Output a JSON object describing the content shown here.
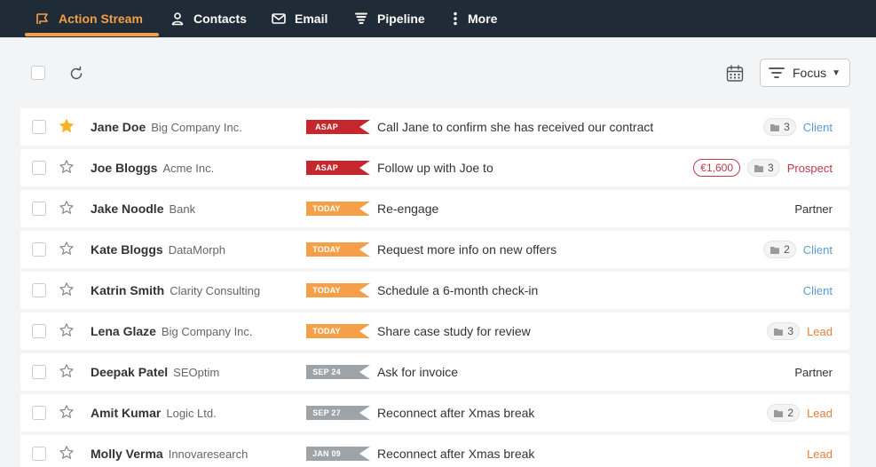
{
  "nav": {
    "items": [
      {
        "label": "Action Stream",
        "icon": "action-stream-icon",
        "active": true
      },
      {
        "label": "Contacts",
        "icon": "person-icon"
      },
      {
        "label": "Email",
        "icon": "envelope-icon"
      },
      {
        "label": "Pipeline",
        "icon": "funnel-icon"
      },
      {
        "label": "More",
        "icon": "vertical-dots-icon"
      }
    ]
  },
  "toolbar": {
    "focus_label": "Focus"
  },
  "colors": {
    "nav_bg": "#1f2b36",
    "accent": "#f5a049",
    "asap": "#c6262e",
    "today": "#f5a049",
    "date": "#9ea3a8",
    "client": "#5b9bd5",
    "prospect": "#c03a4b",
    "lead": "#e67e3c",
    "partner": "#333333"
  },
  "rows": [
    {
      "name": "Jane Doe",
      "company": "Big Company Inc.",
      "starred": true,
      "tag": "ASAP",
      "tag_kind": "asap",
      "task": "Call Jane to confirm she has received our contract",
      "amount": "",
      "count": "3",
      "type": "Client",
      "type_kind": "client"
    },
    {
      "name": "Joe Bloggs",
      "company": "Acme Inc.",
      "starred": false,
      "tag": "ASAP",
      "tag_kind": "asap",
      "task": "Follow up with Joe to",
      "amount": "€1,600",
      "count": "3",
      "type": "Prospect",
      "type_kind": "prospect"
    },
    {
      "name": "Jake Noodle",
      "company": "Bank",
      "starred": false,
      "tag": "TODAY",
      "tag_kind": "today",
      "task": "Re-engage",
      "amount": "",
      "count": "",
      "type": "Partner",
      "type_kind": "partner"
    },
    {
      "name": "Kate Bloggs",
      "company": "DataMorph",
      "starred": false,
      "tag": "TODAY",
      "tag_kind": "today",
      "task": "Request more info on new offers",
      "amount": "",
      "count": "2",
      "type": "Client",
      "type_kind": "client"
    },
    {
      "name": "Katrin Smith",
      "company": "Clarity Consulting",
      "starred": false,
      "tag": "TODAY",
      "tag_kind": "today",
      "task": "Schedule a 6-month check-in",
      "amount": "",
      "count": "",
      "type": "Client",
      "type_kind": "client"
    },
    {
      "name": "Lena Glaze",
      "company": "Big Company Inc.",
      "starred": false,
      "tag": "TODAY",
      "tag_kind": "today",
      "task": "Share case study for review",
      "amount": "",
      "count": "3",
      "type": "Lead",
      "type_kind": "lead"
    },
    {
      "name": "Deepak Patel",
      "company": "SEOptim",
      "starred": false,
      "tag": "SEP 24",
      "tag_kind": "date",
      "task": "Ask for invoice",
      "amount": "",
      "count": "",
      "type": "Partner",
      "type_kind": "partner"
    },
    {
      "name": "Amit Kumar",
      "company": "Logic Ltd.",
      "starred": false,
      "tag": "SEP 27",
      "tag_kind": "date",
      "task": "Reconnect after Xmas break",
      "amount": "",
      "count": "2",
      "type": "Lead",
      "type_kind": "lead"
    },
    {
      "name": "Molly Verma",
      "company": "Innovaresearch",
      "starred": false,
      "tag": "JAN 09",
      "tag_kind": "date",
      "task": "Reconnect after Xmas break",
      "amount": "",
      "count": "",
      "type": "Lead",
      "type_kind": "lead"
    }
  ]
}
